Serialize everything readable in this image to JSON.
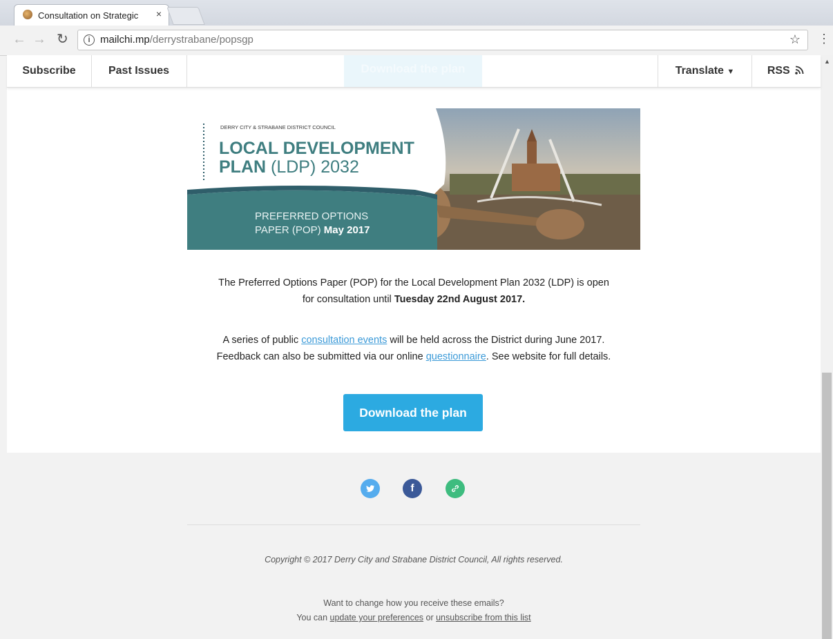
{
  "browser": {
    "tab_title": "Consultation on Strategic",
    "tab_close": "×",
    "url_host": "mailchi.mp",
    "url_path": "/derrystrabane/popsgp"
  },
  "navbar": {
    "subscribe": "Subscribe",
    "past_issues": "Past Issues",
    "ghost_button": "Download the plan",
    "translate": "Translate",
    "rss": "RSS"
  },
  "banner": {
    "council": "DERRY CITY & STRABANE DISTRICT COUNCIL",
    "line1": "LOCAL DEVELOPMENT",
    "line2_bold": "PLAN",
    "line2_rest": "(LDP) 2032",
    "pop_line1": "PREFERRED OPTIONS",
    "pop_line2": "PAPER (POP)",
    "pop_date": "May 2017"
  },
  "body": {
    "para1_a": "The Preferred Options Paper (POP) for the Local Development Plan 2032 (LDP) is open",
    "para1_b": "for consultation until ",
    "para1_bold": "Tuesday 22nd August 2017.",
    "para2_a": "A series of public ",
    "para2_link": "consultation events",
    "para2_b": " will be held across the District during June 2017.",
    "para2_c": "Feedback can also be submitted via our online ",
    "para2_link2": "questionnaire",
    "para2_d": ". See website for full details.",
    "download_button": "Download the plan"
  },
  "footer": {
    "copyright": "Copyright © 2017 Derry City and Strabane District Council, All rights reserved.",
    "pref_line1": "Want to change how you receive these emails?",
    "pref_a": "You can ",
    "pref_link1": "update your preferences",
    "pref_b": " or ",
    "pref_link2": "unsubscribe from this list"
  },
  "colors": {
    "button": "#2caae1",
    "link": "#3b9ad8",
    "teal": "#3f7e80",
    "twitter": "#55acee",
    "facebook": "#3b5998",
    "link_icon": "#3ebc7f"
  },
  "icons": [
    "back-icon",
    "forward-icon",
    "reload-icon",
    "info-icon",
    "star-icon",
    "menu-icon",
    "rss-icon",
    "twitter-icon",
    "facebook-icon",
    "link-icon"
  ]
}
